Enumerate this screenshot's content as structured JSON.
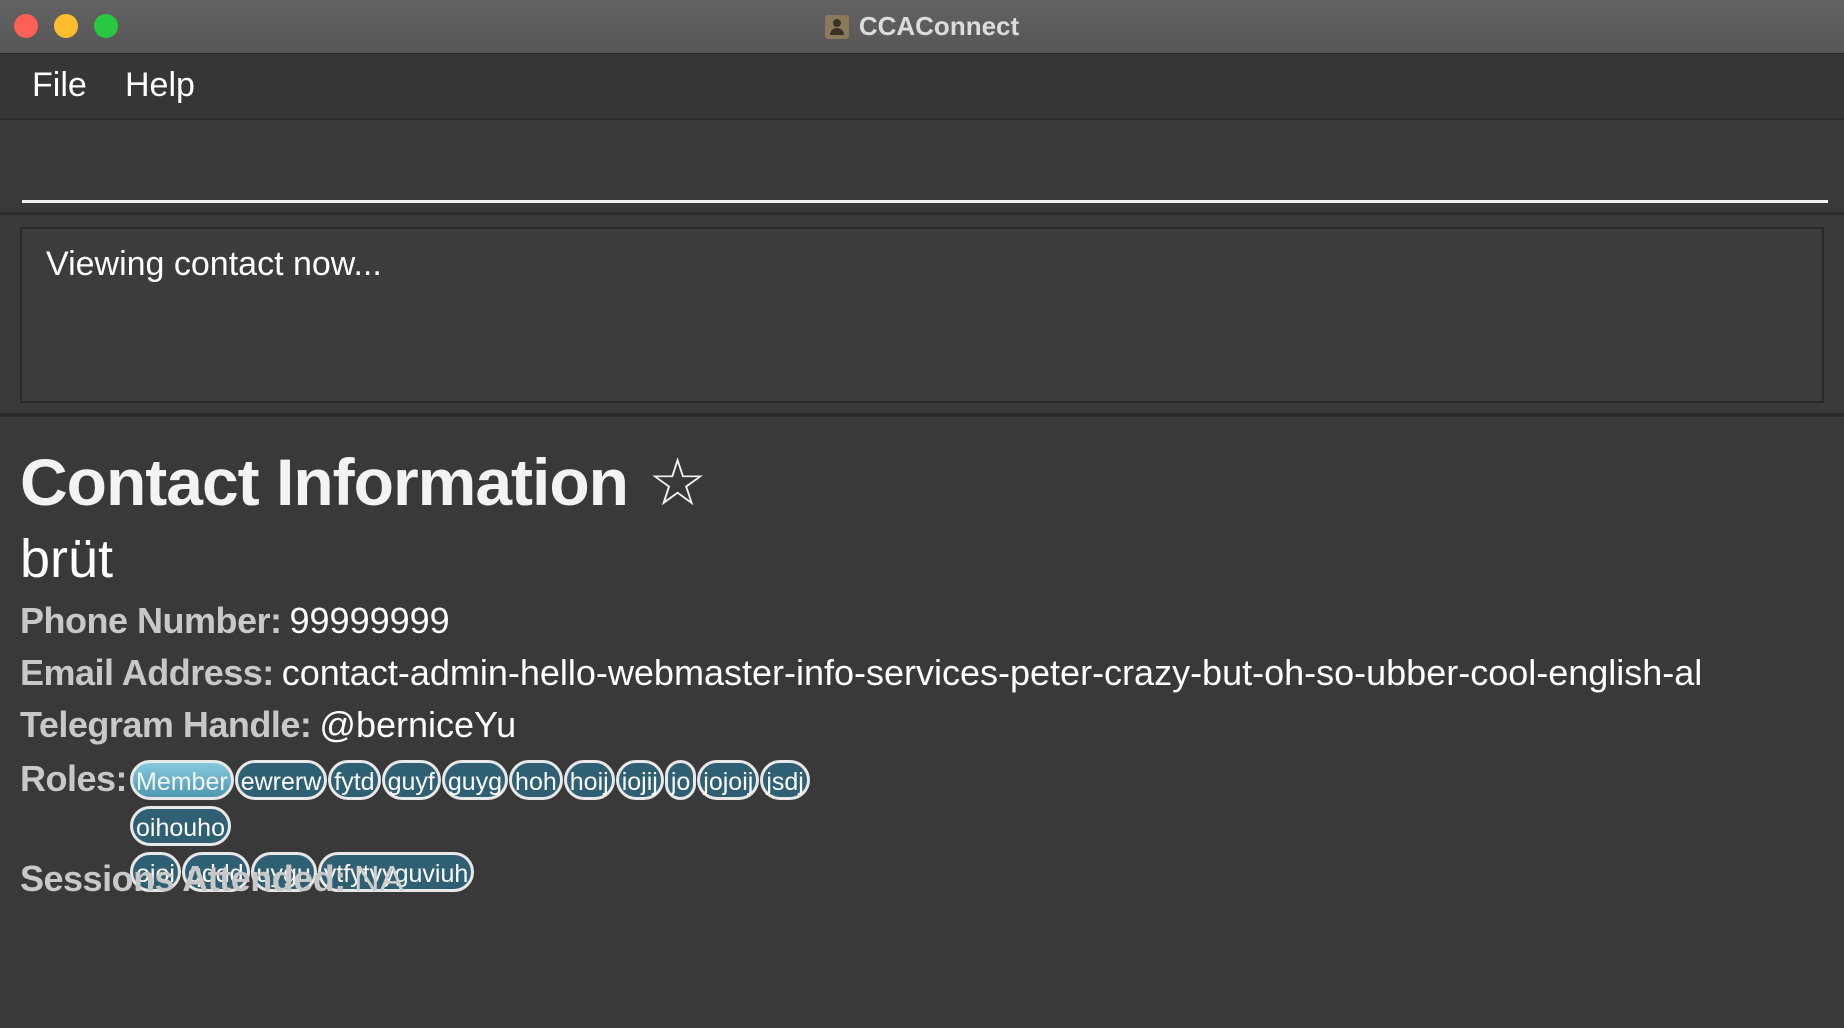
{
  "window": {
    "title": "CCAConnect",
    "icon": "contact-book-icon"
  },
  "menu": {
    "file_label": "File",
    "help_label": "Help"
  },
  "command": {
    "value": "",
    "placeholder": ""
  },
  "result": {
    "message": "Viewing contact now..."
  },
  "contact": {
    "heading": "Contact Information",
    "star_symbol": "☆",
    "name": "brüt",
    "phone_label": "Phone Number:",
    "phone": "99999999",
    "email_label": "Email Address:",
    "email": "contact-admin-hello-webmaster-info-services-peter-crazy-but-oh-so-ubber-cool-english-al",
    "telegram_label": "Telegram Handle:",
    "telegram": "@berniceYu",
    "roles_label": "Roles:",
    "roles": [
      "Member",
      "ewrerw",
      "fytd",
      "guyf",
      "guyg",
      "hoh",
      "hoij",
      "iojij",
      "jo",
      "jojoij",
      "jsdj",
      "oihouho",
      "ojoi",
      "qddd",
      "uygu",
      "ytfytvyguviuh"
    ],
    "sessions_label": "Sessions Attended:",
    "sessions": "NA"
  },
  "colors": {
    "background": "#3b3b3b",
    "tag_primary": "#6bb2c8",
    "tag_default": "#2f5f72",
    "close": "#fe5f57",
    "minimize": "#febc2e",
    "maximize": "#28c840"
  }
}
